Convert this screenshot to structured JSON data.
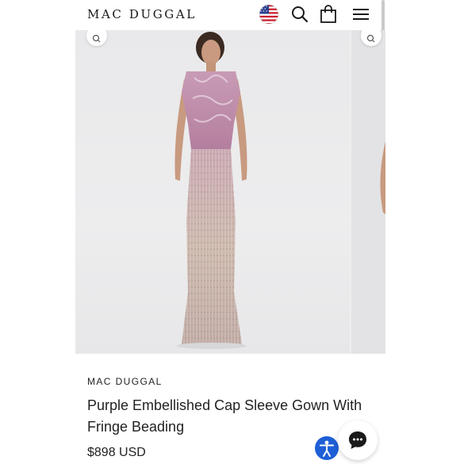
{
  "header": {
    "brand": "MAC DUGGAL",
    "icons": [
      "us-flag-icon",
      "search-icon",
      "shopping-bag-icon",
      "hamburger-menu-icon"
    ]
  },
  "gallery": {
    "main_image": "model wearing purple embellished cap sleeve gown with fringe beading",
    "zoom_icons": [
      "zoom-icon",
      "zoom-icon"
    ]
  },
  "product": {
    "brand": "MAC DUGGAL",
    "title": "Purple Embellished Cap Sleeve Gown With Fringe Beading",
    "price": "$898 USD"
  },
  "widgets": {
    "accessibility_icon": "accessibility-icon",
    "chat_icon": "chat-icon"
  },
  "colors": {
    "accessibility_blue": "#1e5fd6",
    "dress_mauve": "#b98aa6",
    "dress_fringe": "#cdb9a8"
  }
}
